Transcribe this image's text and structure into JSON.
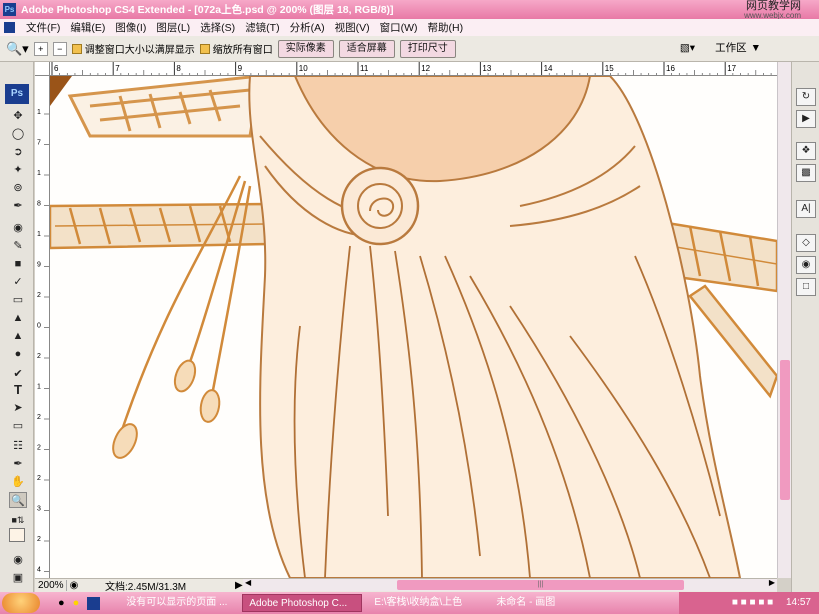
{
  "window": {
    "title": "Adobe Photoshop CS4 Extended - [072a上色.psd @ 200% (图层 18, RGB/8)]",
    "watermark_line1": "网页教学网",
    "watermark_line2": "www.webjx.com"
  },
  "menubar": {
    "items": [
      "文件(F)",
      "编辑(E)",
      "图像(I)",
      "图层(L)",
      "选择(S)",
      "滤镜(T)",
      "分析(A)",
      "视图(V)",
      "窗口(W)",
      "帮助(H)"
    ]
  },
  "options": {
    "resize_windows_label": "调整窗口大小以满屏显示",
    "zoom_all_label": "缩放所有窗口",
    "actual_pixels_label": "实际像素",
    "fit_screen_label": "适合屏幕",
    "print_size_label": "打印尺寸",
    "workspace_label": "工作区"
  },
  "ruler_top": {
    "ticks": [
      "6",
      "7",
      "8",
      "9",
      "10",
      "11",
      "12",
      "13",
      "14",
      "15",
      "16",
      "17"
    ]
  },
  "ruler_left": {
    "ticks": [
      "1",
      "7",
      "1",
      "8",
      "1",
      "9",
      "2",
      "0",
      "2",
      "1",
      "2",
      "2",
      "2",
      "3",
      "2",
      "4"
    ]
  },
  "statusbar": {
    "zoom": "200%",
    "doc_info": "文档:2.45M/31.3M"
  },
  "taskbar": {
    "tasks": [
      {
        "label": "没有可以显示的页面 ..."
      },
      {
        "label": "Adobe Photoshop C..."
      },
      {
        "label": "E:\\客栈\\收纳盒\\上色"
      },
      {
        "label": "未命名 - 画图"
      }
    ],
    "clock": "14:57"
  },
  "colors": {
    "title_pink": "#e879a6",
    "taskbar_pink": "#e783ac",
    "scroll_thumb": "#f09ac0",
    "cloth": "#fdeedd",
    "skin": "#f6cfab",
    "sword": "#d18a3a"
  }
}
